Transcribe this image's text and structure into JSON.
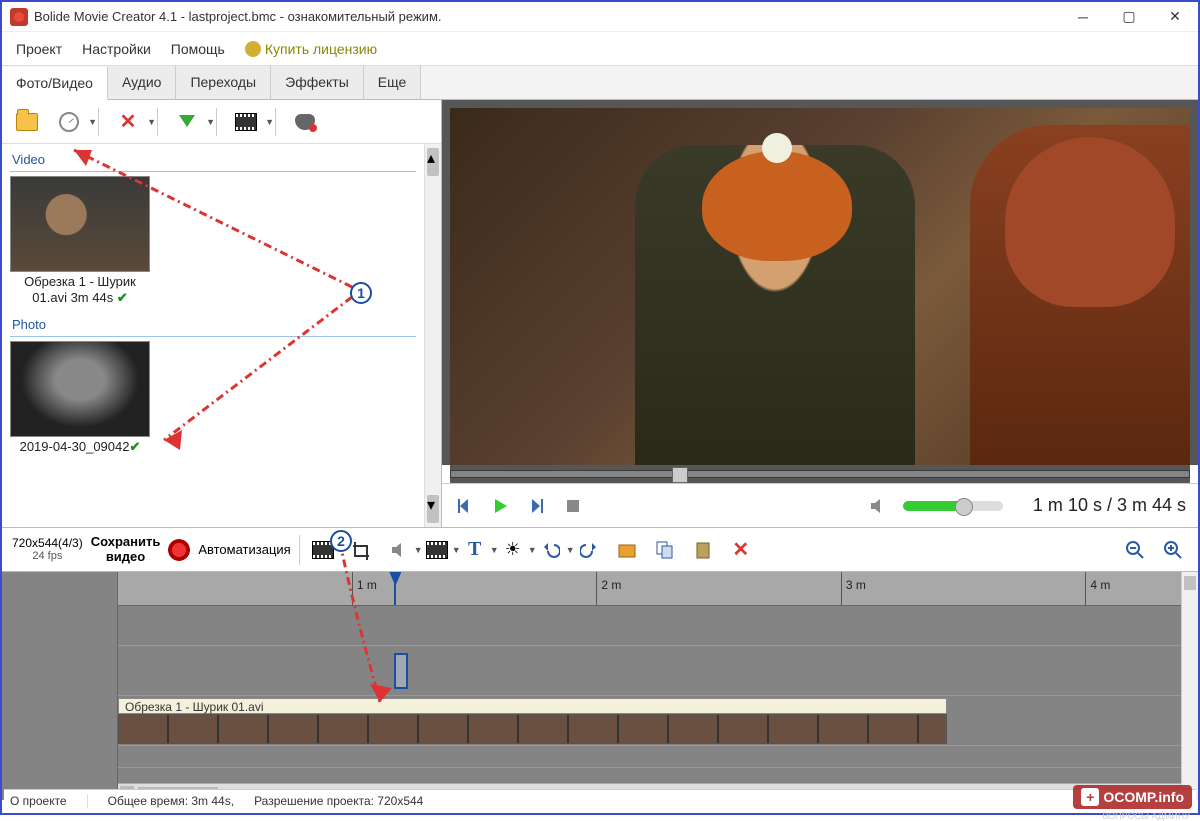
{
  "titlebar": {
    "title": "Bolide Movie Creator 4.1 - lastproject.bmc  - ознакомительный режим."
  },
  "menu": {
    "project": "Проект",
    "settings": "Настройки",
    "help": "Помощь",
    "buy": "Купить лицензию"
  },
  "tabs": {
    "photovideo": "Фото/Видео",
    "audio": "Аудио",
    "transitions": "Переходы",
    "effects": "Эффекты",
    "more": "Еще"
  },
  "media": {
    "video_section": "Video",
    "photo_section": "Photo",
    "clip1_line1": "Обрезка 1 - Шурик",
    "clip1_line2": "01.avi 3m 44s",
    "photo1": "2019-04-30_09042"
  },
  "preview": {
    "time_current": "1 m 10 s",
    "time_sep": " / ",
    "time_total": "3 m 44 s"
  },
  "tl_toolbar": {
    "resolution": "720x544(4/3)",
    "fps": "24 fps",
    "save1": "Сохранить",
    "save2": "видео",
    "auto": "Автоматизация"
  },
  "ruler": {
    "m1": "1 m",
    "m2": "2 m",
    "m3": "3 m",
    "m4": "4 m"
  },
  "timeline": {
    "clip_title": "Обрезка 1 - Шурик 01.avi"
  },
  "status": {
    "about": "О проекте",
    "total": "Общее время:  3m 44s,",
    "res": "Разрешение проекта:   720x544"
  },
  "annotations": {
    "b1": "1",
    "b2": "2"
  },
  "watermark": {
    "text": "OCOMP.info",
    "sub": "ВОПРОСЫ АДМИНУ"
  }
}
